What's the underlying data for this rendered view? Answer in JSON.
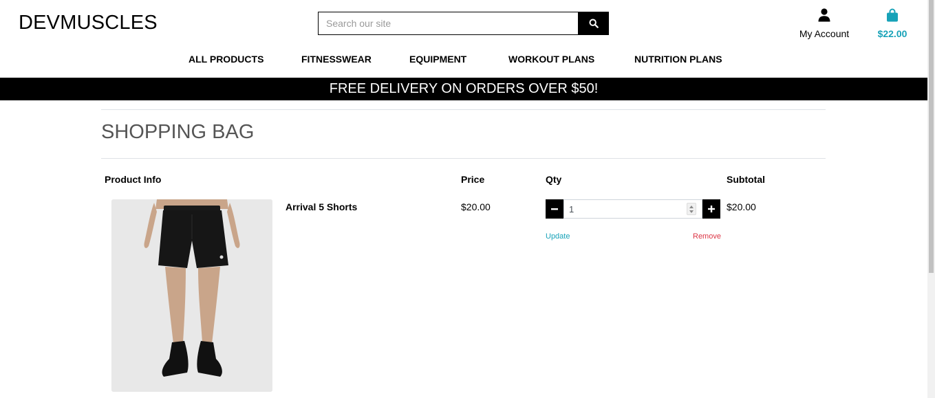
{
  "header": {
    "logo": "DEVMUSCLES",
    "search_placeholder": "Search our site",
    "account_label": "My Account",
    "bag_total": "$22.00"
  },
  "nav": {
    "items": [
      "ALL PRODUCTS",
      "FITNESSWEAR",
      "EQUIPMENT",
      "WORKOUT PLANS",
      "NUTRITION PLANS"
    ]
  },
  "banner": "FREE DELIVERY ON ORDERS OVER $50!",
  "page": {
    "title": "SHOPPING BAG"
  },
  "table": {
    "headers": [
      "Product Info",
      "Price",
      "Qty",
      "Subtotal"
    ],
    "rows": [
      {
        "name": "Arrival 5 Shorts",
        "price": "$20.00",
        "qty": "1",
        "subtotal": "$20.00",
        "update_label": "Update",
        "remove_label": "Remove"
      }
    ]
  },
  "colors": {
    "accent": "#17a2b8",
    "danger": "#dc3545",
    "banner_bg": "#000000",
    "banner_text": "#ffffff"
  },
  "icons": {
    "search": "search-icon",
    "account": "user-icon",
    "bag": "shopping-bag-icon",
    "minus": "minus-icon",
    "plus": "plus-icon"
  }
}
